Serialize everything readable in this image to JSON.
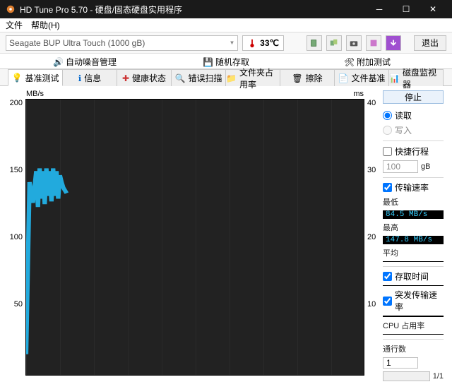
{
  "window": {
    "title": "HD Tune Pro 5.70 - 硬盘/固态硬盘实用程序"
  },
  "menu": {
    "file": "文件",
    "help": "帮助(H)"
  },
  "toolbar": {
    "drive": "Seagate BUP Ultra Touch (1000 gB)",
    "temp": "33℃",
    "exit": "退出"
  },
  "tabs_top": {
    "auto_noise": "自动噪音管理",
    "random_access": "随机存取",
    "extra_tests": "附加测试"
  },
  "tabs_main": {
    "benchmark": "基准测试",
    "info": "信息",
    "health": "健康状态",
    "error_scan": "错误扫描",
    "folder_usage": "文件夹占用率",
    "erase": "擦除",
    "file_bench": "文件基准",
    "disk_monitor": "磁盘监视器"
  },
  "chart_data": {
    "type": "line",
    "y_left_label": "MB/s",
    "y_right_label": "ms",
    "y_left_ticks": [
      "200",
      "150",
      "100",
      "50"
    ],
    "y_right_ticks": [
      "40",
      "30",
      "20",
      "10"
    ],
    "ylim_left": [
      0,
      200
    ],
    "ylim_right": [
      0,
      40
    ],
    "series": [
      {
        "name": "transfer_rate",
        "x_fraction": true,
        "points": [
          [
            0.0,
            15
          ],
          [
            0.01,
            140
          ],
          [
            0.02,
            125
          ],
          [
            0.03,
            148
          ],
          [
            0.035,
            122
          ],
          [
            0.04,
            150
          ],
          [
            0.045,
            128
          ],
          [
            0.05,
            148
          ],
          [
            0.055,
            124
          ],
          [
            0.06,
            150
          ],
          [
            0.065,
            130
          ],
          [
            0.07,
            148
          ],
          [
            0.075,
            126
          ],
          [
            0.08,
            150
          ],
          [
            0.085,
            130
          ],
          [
            0.09,
            148
          ],
          [
            0.095,
            128
          ],
          [
            0.1,
            145
          ],
          [
            0.105,
            140
          ],
          [
            0.11,
            136
          ],
          [
            0.115,
            134
          ],
          [
            0.12,
            132
          ]
        ]
      }
    ]
  },
  "side": {
    "stop": "停止",
    "read": "读取",
    "write": "写入",
    "short_stroke": "快捷行程",
    "short_stroke_val": "100",
    "unit_gb": "gB",
    "transfer_rate": "传输速率",
    "min_label": "最低",
    "min_value": "84.5 MB/s",
    "max_label": "最高",
    "max_value": "147.8 MB/s",
    "avg_label": "平均",
    "avg_value": "",
    "access_time": "存取时间",
    "access_value": "",
    "burst_rate": "突发传输速率",
    "burst_value": "",
    "cpu_usage": "CPU 占用率",
    "cpu_value": "",
    "passes": "通行数",
    "passes_val": "1",
    "passes_disp": "1/1"
  }
}
